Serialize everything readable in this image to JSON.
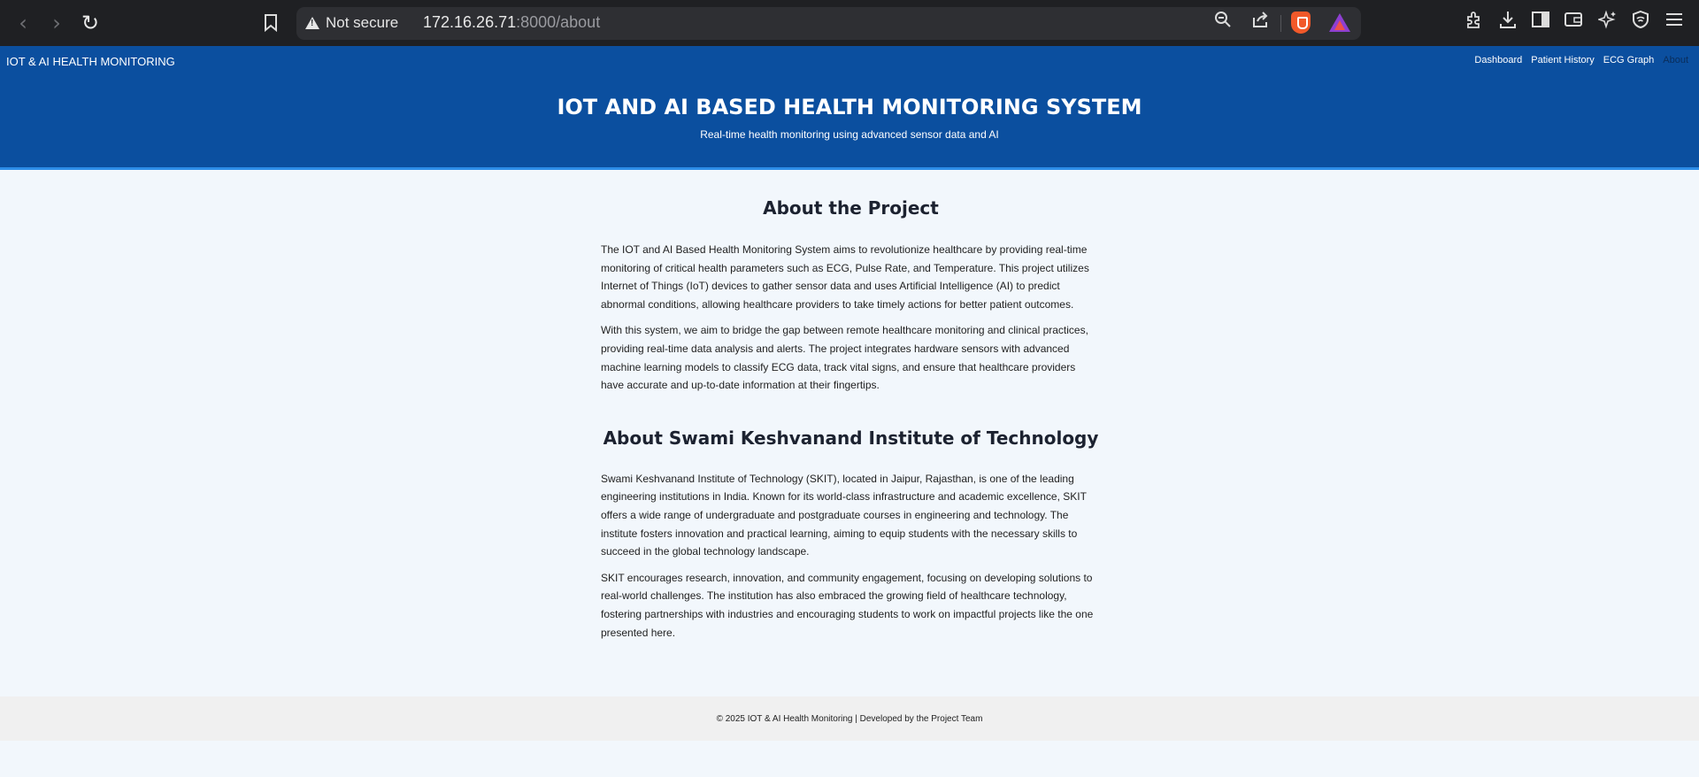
{
  "browser": {
    "back_glyph": "‹",
    "forward_glyph": "›",
    "reload_glyph": "↻",
    "security_label": "Not secure",
    "url_host": "172.16.26.71",
    "url_rest": ":8000/about"
  },
  "site": {
    "brand": "IOT & AI HEALTH MONITORING",
    "nav": [
      {
        "label": "Dashboard"
      },
      {
        "label": "Patient History"
      },
      {
        "label": "ECG Graph"
      },
      {
        "label": "About"
      }
    ],
    "hero_title": "IOT AND AI BASED HEALTH MONITORING SYSTEM",
    "hero_subtitle": "Real-time health monitoring using advanced sensor data and AI"
  },
  "about_project": {
    "heading": "About the Project",
    "paragraphs": [
      "The IOT and AI Based Health Monitoring System aims to revolutionize healthcare by providing real-time monitoring of critical health parameters such as ECG, Pulse Rate, and Temperature. This project utilizes Internet of Things (IoT) devices to gather sensor data and uses Artificial Intelligence (AI) to predict abnormal conditions, allowing healthcare providers to take timely actions for better patient outcomes.",
      "With this system, we aim to bridge the gap between remote healthcare monitoring and clinical practices, providing real-time data analysis and alerts. The project integrates hardware sensors with advanced machine learning models to classify ECG data, track vital signs, and ensure that healthcare providers have accurate and up-to-date information at their fingertips."
    ]
  },
  "about_institute": {
    "heading": "About Swami Keshvanand Institute of Technology",
    "paragraphs": [
      "Swami Keshvanand Institute of Technology (SKIT), located in Jaipur, Rajasthan, is one of the leading engineering institutions in India. Known for its world-class infrastructure and academic excellence, SKIT offers a wide range of undergraduate and postgraduate courses in engineering and technology. The institute fosters innovation and practical learning, aiming to equip students with the necessary skills to succeed in the global technology landscape.",
      "SKIT encourages research, innovation, and community engagement, focusing on developing solutions to real-world challenges. The institution has also embraced the growing field of healthcare technology, fostering partnerships with industries and encouraging students to work on impactful projects like the one presented here."
    ]
  },
  "footer": {
    "text": "© 2025 IOT & AI Health Monitoring | Developed by the Project Team"
  },
  "colors": {
    "header_bg": "#0b4f9f",
    "header_border": "#2e8ee8",
    "page_bg": "#f2f7fc",
    "footer_bg": "#f0f0f0",
    "browser_bg": "#1f2023"
  }
}
